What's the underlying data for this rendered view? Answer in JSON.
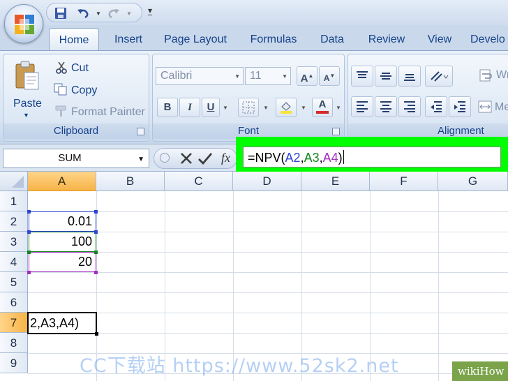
{
  "ribbon_tabs": [
    "Home",
    "Insert",
    "Page Layout",
    "Formulas",
    "Data",
    "Review",
    "View",
    "Develo"
  ],
  "clipboard": {
    "paste_label": "Paste",
    "cut_label": "Cut",
    "copy_label": "Copy",
    "format_painter_label": "Format Painter",
    "group_label": "Clipboard"
  },
  "font": {
    "font_name": "Calibri",
    "font_size": "11",
    "group_label": "Font",
    "bold": "B",
    "italic": "I",
    "underline": "U"
  },
  "alignment": {
    "group_label": "Alignment",
    "wrap_label": "Wr",
    "merge_label": "Me"
  },
  "formula_bar": {
    "name_box": "SUM",
    "fx": "fx",
    "formula_prefix": "=NPV(",
    "ref1": "A2",
    "sep1": ",",
    "ref2": "A3",
    "sep2": ",",
    "ref3": "A4",
    "formula_suffix": ")"
  },
  "grid": {
    "columns": [
      "A",
      "B",
      "C",
      "D",
      "E",
      "F",
      "G"
    ],
    "rows": [
      "1",
      "2",
      "3",
      "4",
      "5",
      "6",
      "7",
      "8",
      "9"
    ],
    "cells": {
      "A2": "0.01",
      "A3": "100",
      "A4": "20",
      "A7": "2,A3,A4)"
    }
  },
  "watermark": "CC下载站 https://www.52sk2.net",
  "badge": "wikiHow"
}
